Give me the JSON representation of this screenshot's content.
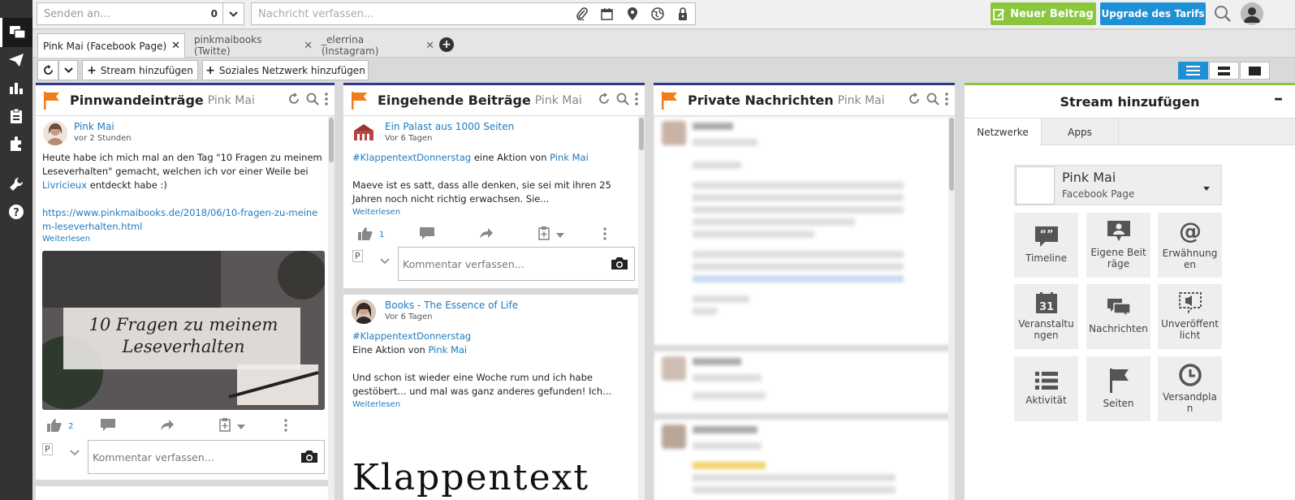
{
  "topbar": {
    "sender_placeholder": "Senden an...",
    "sender_count": "0",
    "composer_placeholder": "Nachricht verfassen...",
    "new_post_label": "Neuer Beitrag",
    "upgrade_label": "Upgrade des Tarifs"
  },
  "tabs": [
    {
      "label": "Pink Mai (Facebook Page)",
      "active": true
    },
    {
      "label": "pinkmaibooks (Twitte)",
      "active": false
    },
    {
      "label": "_elerrina (Instagram)",
      "active": false
    }
  ],
  "toolbar": {
    "add_stream": "Stream hinzufügen",
    "add_network": "Soziales Netzwerk hinzufügen"
  },
  "columns": [
    {
      "title": "Pinnwandeinträge",
      "sub": "Pink Mai",
      "post": {
        "name": "Pink Mai",
        "time": "vor 2 Stunden",
        "text_1": "Heute habe ich mich mal an den Tag \"10 Fragen zu meinem Leseverhalten\" gemacht, welchen ich vor einer Weile bei",
        "mention": "Livricieux",
        "text_2": "entdeckt habe :)",
        "url": "https://www.pinkmaibooks.de/2018/06/10-fragen-zu-meinem-leseverhalten.html",
        "more": "Weiterlesen",
        "image_line_1": "10 Fragen zu meinem",
        "image_line_2": "Leseverhalten",
        "likes": "2",
        "comment_placeholder": "Kommentar verfassen...",
        "avatar_alt": "P"
      }
    },
    {
      "title": "Eingehende Beiträge",
      "sub": "Pink Mai",
      "post1": {
        "name": "Ein Palast aus 1000 Seiten",
        "time": "Vor 6 Tagen",
        "hashtag": "#KlappentextDonnerstag",
        "text_1": "eine Aktion von",
        "mention": "Pink Mai",
        "text_2": "Maeve ist es satt, dass alle denken, sie sei mit ihren 25 Jahren noch nicht richtig erwachsen. Sie...",
        "more": "Weiterlesen",
        "likes": "1",
        "comment_placeholder": "Kommentar verfassen...",
        "avatar_alt": "P"
      },
      "post2": {
        "name": "Books - The Essence of Life",
        "time": "Vor 6 Tagen",
        "hashtag": "#KlappentextDonnerstag",
        "text_1": "Eine Aktion von",
        "mention": "Pink Mai",
        "text_2": "Und schon ist wieder eine Woche rum und ich habe gestöbert... und mal was ganz anderes gefunden! Ich...",
        "more": "Weiterlesen",
        "image_text": "Klappentext"
      }
    },
    {
      "title": "Private Nachrichten",
      "sub": "Pink Mai"
    }
  ],
  "stream_panel": {
    "title": "Stream hinzufügen",
    "tab_networks": "Netzwerke",
    "tab_apps": "Apps",
    "account_name": "Pink Mai",
    "account_type": "Facebook Page",
    "tiles": [
      {
        "label": "Timeline",
        "icon": "timeline-icon"
      },
      {
        "label": "Eigene Beiträge",
        "icon": "own-posts-icon"
      },
      {
        "label": "Erwähnungen",
        "icon": "mentions-icon"
      },
      {
        "label": "Veranstaltungen",
        "icon": "events-icon"
      },
      {
        "label": "Nachrichten",
        "icon": "messages-icon"
      },
      {
        "label": "Unveröffentlicht",
        "icon": "unpublished-icon"
      },
      {
        "label": "Aktivität",
        "icon": "activity-icon"
      },
      {
        "label": "Seiten",
        "icon": "pages-icon"
      },
      {
        "label": "Versandplan",
        "icon": "schedule-icon"
      }
    ],
    "calendar_day": "31"
  },
  "colors": {
    "accent_blue": "#1e90d6",
    "accent_green": "#8cc63f",
    "column_border": "#2e3a8c",
    "flag_orange": "#f07d1a",
    "link": "#1e7bbf"
  }
}
